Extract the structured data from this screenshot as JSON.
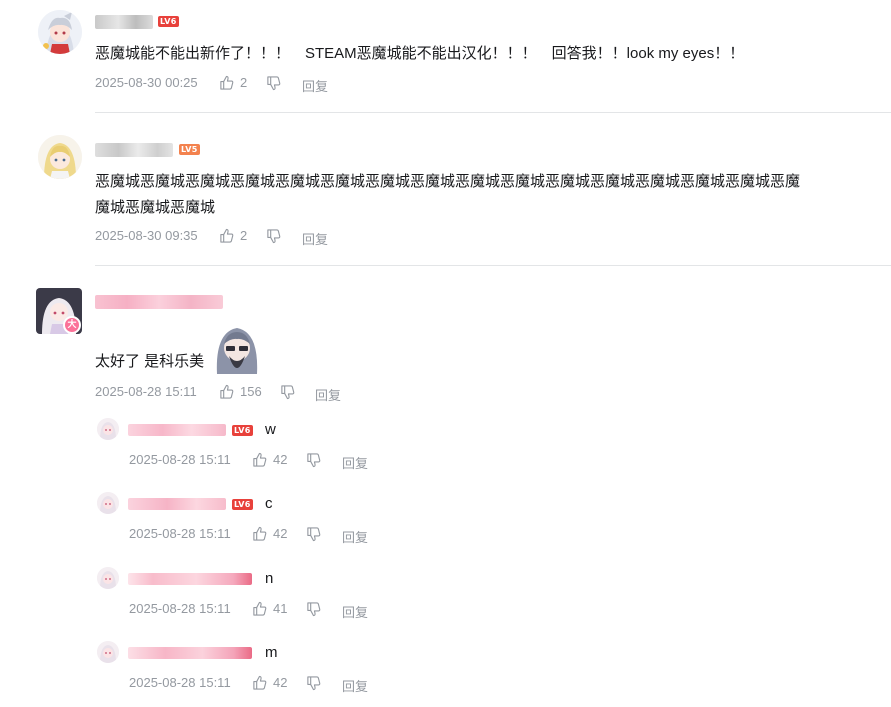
{
  "comments": [
    {
      "level": "LV6",
      "text": "恶魔城能不能出新作了！！！　STEAM恶魔城能不能出汉化！！！　回答我！！look my eyes！！",
      "time": "2025-08-30 00:25",
      "likes": "2",
      "reply_label": "回复"
    },
    {
      "level": "LV5",
      "text_line1": "恶魔城恶魔城恶魔城恶魔城恶魔城恶魔城恶魔城恶魔城恶魔城恶魔城恶魔城恶魔城恶魔城恶魔城恶魔城恶魔",
      "text_line2": "魔城恶魔城恶魔城",
      "time": "2025-08-30 09:35",
      "likes": "2",
      "reply_label": "回复"
    },
    {
      "badge": "大",
      "text": "太好了 是科乐美",
      "time": "2025-08-28 15:11",
      "likes": "156",
      "reply_label": "回复",
      "replies": [
        {
          "level": "LV6",
          "text": "w",
          "time": "2025-08-28 15:11",
          "likes": "42",
          "reply_label": "回复"
        },
        {
          "level": "LV6",
          "text": "c",
          "time": "2025-08-28 15:11",
          "likes": "42",
          "reply_label": "回复"
        },
        {
          "level": "",
          "text": "n",
          "time": "2025-08-28 15:11",
          "likes": "41",
          "reply_label": "回复"
        },
        {
          "level": "",
          "text": "m",
          "time": "2025-08-28 15:11",
          "likes": "42",
          "reply_label": "回复"
        }
      ]
    }
  ],
  "colors": {
    "lv6": "#e8413b",
    "lv5": "#f3824e",
    "vip_pink": "#f7b6c8",
    "meta_gray": "#9499a0",
    "divider": "#e3e5e7"
  }
}
